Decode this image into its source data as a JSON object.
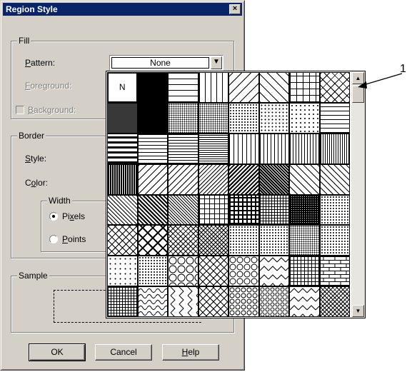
{
  "window": {
    "title": "Region Style",
    "close_glyph": "×"
  },
  "fill": {
    "group_label": "Fill",
    "pattern_label_u": "P",
    "pattern_label_rest": "attern:",
    "pattern_value": "None",
    "foreground_label_u": "F",
    "foreground_label_rest": "oreground:",
    "background_label_u": "B",
    "background_label_rest": "ackground:"
  },
  "border": {
    "group_label": "Border",
    "style_label_u": "S",
    "style_label_rest": "tyle:",
    "color_label_pre": "C",
    "color_label_u": "o",
    "color_label_rest": "lor:",
    "width_group_label": "Width",
    "pixels_pre": "Pi",
    "pixels_u": "x",
    "pixels_rest": "els",
    "points_u": "P",
    "points_rest": "oints",
    "selected_width": "Pixels"
  },
  "sample": {
    "group_label": "Sample"
  },
  "buttons": {
    "ok": "OK",
    "cancel": "Cancel",
    "help_u": "H",
    "help_rest": "elp"
  },
  "palette": {
    "selected_cell_label": "N",
    "patterns": [
      "none",
      "solid",
      "hlines-wide",
      "vlines-wide",
      "diag-up-wide",
      "diag-down-wide",
      "grid-wide",
      "crosshatch-wide",
      "dots-dense",
      "dots-dark",
      "dots-medium",
      "dots-gray",
      "dots-light",
      "dots-sparse",
      "dots-sparser",
      "hlines-medium",
      "hlines-thick",
      "hlines-thin",
      "hlines-dense",
      "hlines-very-dense",
      "vlines-medium",
      "vlines-thin",
      "vlines-dense",
      "vlines-very-dense",
      "vlines-heavy",
      "diag-up-medium",
      "diag-up-thin",
      "diag-up-dense",
      "diag-up-heavy",
      "diag-down-dark",
      "diag-down-medium",
      "diag-down-thin",
      "diag-down-dense",
      "diag-down-heavy",
      "diag-down-very-dense",
      "grid-medium",
      "grid-thick",
      "grid-fine",
      "grid-dense",
      "dots-tiny",
      "diamond-open",
      "diamond-bold",
      "diamond-dotted",
      "diamond-gray",
      "confetti",
      "confetti-light",
      "dots-fine-gray",
      "hatch-light",
      "dots-scatter",
      "dots-scatter-light",
      "circles",
      "checker-wave",
      "scales",
      "zigzag-wave",
      "brick-grid",
      "brick",
      "small-grid",
      "waves",
      "zigzag-v",
      "diag-weave",
      "scales-small",
      "scales-fine",
      "zigzag-horizontal",
      "weave-dense"
    ]
  },
  "callout": {
    "number": "1"
  }
}
